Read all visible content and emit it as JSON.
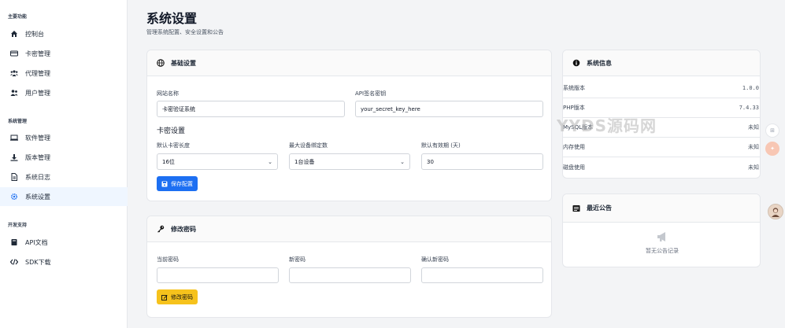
{
  "sidebar": {
    "sections": [
      {
        "title": "主要功能",
        "items": [
          {
            "label": "控制台",
            "icon": "home-icon"
          },
          {
            "label": "卡密管理",
            "icon": "card-icon"
          },
          {
            "label": "代理管理",
            "icon": "users-group-icon"
          },
          {
            "label": "用户管理",
            "icon": "user-icon"
          }
        ]
      },
      {
        "title": "系统管理",
        "items": [
          {
            "label": "软件管理",
            "icon": "software-icon"
          },
          {
            "label": "版本管理",
            "icon": "download-icon"
          },
          {
            "label": "系统日志",
            "icon": "file-icon"
          },
          {
            "label": "系统设置",
            "icon": "gear-icon",
            "active": true
          }
        ]
      },
      {
        "title": "开发支持",
        "items": [
          {
            "label": "API文档",
            "icon": "book-icon"
          },
          {
            "label": "SDK下载",
            "icon": "code-icon"
          }
        ]
      }
    ]
  },
  "header": {
    "title": "系统设置",
    "subtitle": "管理系统配置、安全设置和公告"
  },
  "basic": {
    "title": "基础设置",
    "site_name_label": "网站名称",
    "site_name_value": "卡密验证系统",
    "api_key_label": "API签名密钥",
    "api_key_value": "your_secret_key_here",
    "card_section_title": "卡密设置",
    "card_length_label": "默认卡密长度",
    "card_length_value": "16位",
    "max_device_label": "最大设备绑定数",
    "max_device_value": "1台设备",
    "validity_label": "默认有效期 (天)",
    "validity_value": "30",
    "save_label": "保存配置"
  },
  "password": {
    "title": "修改密码",
    "current_label": "当前密码",
    "new_label": "新密码",
    "confirm_label": "确认新密码",
    "submit_label": "修改密码"
  },
  "sysinfo": {
    "title": "系统信息",
    "rows": [
      {
        "label": "系统版本",
        "value": "1.0.0"
      },
      {
        "label": "PHP版本",
        "value": "7.4.33"
      },
      {
        "label": "MySQL版本",
        "value": "未知"
      },
      {
        "label": "内存使用",
        "value": "未知"
      },
      {
        "label": "磁盘使用",
        "value": "未知"
      }
    ]
  },
  "announce": {
    "title": "最近公告",
    "empty_text": "暂无公告记录"
  },
  "watermark": "YYDS源码网",
  "colors": {
    "primary": "#1d6ff2",
    "warning": "#f6c21c",
    "active_bg": "#eff6ff"
  }
}
